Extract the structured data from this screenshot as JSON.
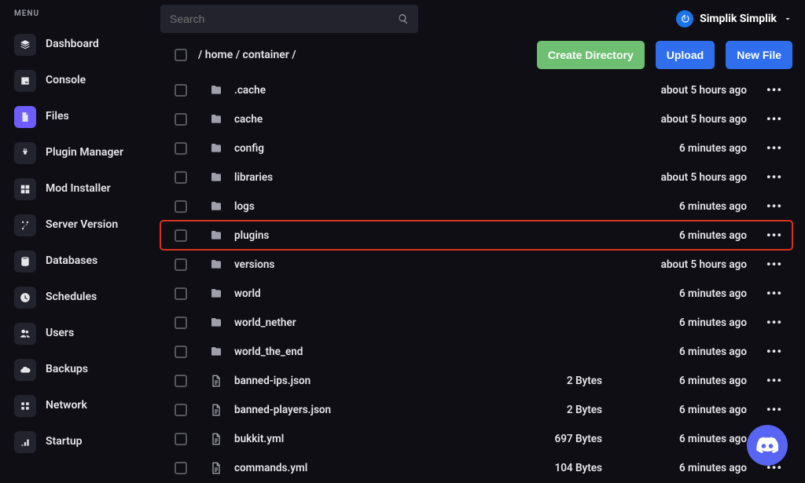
{
  "menuLabel": "MENU",
  "nav": [
    {
      "label": "Dashboard",
      "icon": "layers"
    },
    {
      "label": "Console",
      "icon": "terminal"
    },
    {
      "label": "Files",
      "icon": "file",
      "active": true
    },
    {
      "label": "Plugin Manager",
      "icon": "plug"
    },
    {
      "label": "Mod Installer",
      "icon": "grid"
    },
    {
      "label": "Server Version",
      "icon": "branch"
    },
    {
      "label": "Databases",
      "icon": "db"
    },
    {
      "label": "Schedules",
      "icon": "clock"
    },
    {
      "label": "Users",
      "icon": "users"
    },
    {
      "label": "Backups",
      "icon": "cloud"
    },
    {
      "label": "Network",
      "icon": "net"
    },
    {
      "label": "Startup",
      "icon": "bars"
    }
  ],
  "search": {
    "placeholder": "Search"
  },
  "user": {
    "name": "Simplik Simplik"
  },
  "breadcrumb": "/ home / container /",
  "actions": {
    "createDir": "Create Directory",
    "upload": "Upload",
    "newFile": "New File"
  },
  "files": [
    {
      "name": ".cache",
      "type": "folder",
      "size": "",
      "time": "about 5 hours ago"
    },
    {
      "name": "cache",
      "type": "folder",
      "size": "",
      "time": "about 5 hours ago"
    },
    {
      "name": "config",
      "type": "folder",
      "size": "",
      "time": "6 minutes ago"
    },
    {
      "name": "libraries",
      "type": "folder",
      "size": "",
      "time": "about 5 hours ago"
    },
    {
      "name": "logs",
      "type": "folder",
      "size": "",
      "time": "6 minutes ago"
    },
    {
      "name": "plugins",
      "type": "folder",
      "size": "",
      "time": "6 minutes ago",
      "highlight": true
    },
    {
      "name": "versions",
      "type": "folder",
      "size": "",
      "time": "about 5 hours ago"
    },
    {
      "name": "world",
      "type": "folder",
      "size": "",
      "time": "6 minutes ago"
    },
    {
      "name": "world_nether",
      "type": "folder",
      "size": "",
      "time": "6 minutes ago"
    },
    {
      "name": "world_the_end",
      "type": "folder",
      "size": "",
      "time": "6 minutes ago"
    },
    {
      "name": "banned-ips.json",
      "type": "file",
      "size": "2 Bytes",
      "time": "6 minutes ago"
    },
    {
      "name": "banned-players.json",
      "type": "file",
      "size": "2 Bytes",
      "time": "6 minutes ago"
    },
    {
      "name": "bukkit.yml",
      "type": "file",
      "size": "697 Bytes",
      "time": "6 minutes ago"
    },
    {
      "name": "commands.yml",
      "type": "file",
      "size": "104 Bytes",
      "time": "6 minutes ago"
    }
  ]
}
